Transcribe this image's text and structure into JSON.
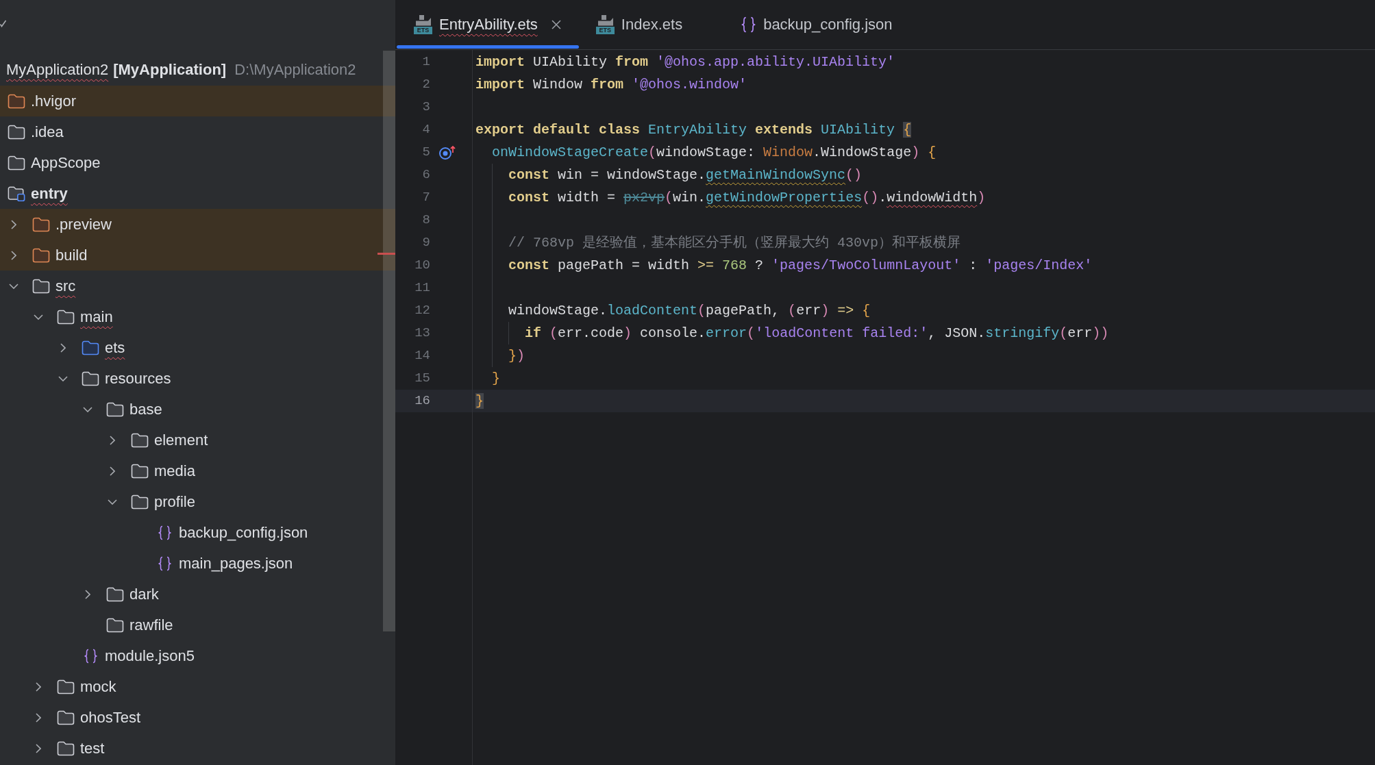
{
  "project_tree": {
    "name": "MyApplication2",
    "module_name": "[MyApplication]",
    "path": "D:\\MyApplication2",
    "misspelled": true,
    "children": [
      {
        "name": ".hvigor",
        "kind": "excluded_folder",
        "misspelled": false
      },
      {
        "name": ".idea",
        "kind": "folder",
        "misspelled": false
      },
      {
        "name": "AppScope",
        "kind": "folder",
        "misspelled": false
      },
      {
        "name": "entry",
        "kind": "module",
        "misspelled": true,
        "children": [
          {
            "name": ".preview",
            "kind": "excluded_folder",
            "expanded": false,
            "misspelled": false
          },
          {
            "name": "build",
            "kind": "excluded_folder",
            "expanded": false,
            "misspelled": false
          },
          {
            "name": "src",
            "kind": "folder",
            "expanded": true,
            "misspelled": true,
            "children": [
              {
                "name": "main",
                "kind": "folder",
                "expanded": true,
                "misspelled": true,
                "children": [
                  {
                    "name": "ets",
                    "kind": "source_folder",
                    "expanded": false,
                    "misspelled": true
                  },
                  {
                    "name": "resources",
                    "kind": "folder",
                    "expanded": true,
                    "misspelled": false,
                    "children": [
                      {
                        "name": "base",
                        "kind": "folder",
                        "expanded": true,
                        "misspelled": false,
                        "children": [
                          {
                            "name": "element",
                            "kind": "folder",
                            "expanded": false,
                            "misspelled": false
                          },
                          {
                            "name": "media",
                            "kind": "folder",
                            "expanded": false,
                            "misspelled": false
                          },
                          {
                            "name": "profile",
                            "kind": "folder",
                            "expanded": true,
                            "misspelled": false,
                            "children": [
                              {
                                "name": "backup_config.json",
                                "kind": "json_file",
                                "misspelled": false
                              },
                              {
                                "name": "main_pages.json",
                                "kind": "json_file",
                                "misspelled": false
                              }
                            ]
                          }
                        ]
                      },
                      {
                        "name": "dark",
                        "kind": "folder",
                        "expanded": false,
                        "misspelled": false
                      },
                      {
                        "name": "rawfile",
                        "kind": "folder",
                        "misspelled": false
                      }
                    ]
                  },
                  {
                    "name": "module.json5",
                    "kind": "json_file",
                    "misspelled": false
                  }
                ]
              },
              {
                "name": "mock",
                "kind": "folder",
                "expanded": false,
                "misspelled": false
              },
              {
                "name": "ohosTest",
                "kind": "folder",
                "expanded": false,
                "misspelled": false
              },
              {
                "name": "test",
                "kind": "folder",
                "expanded": false,
                "misspelled": false
              }
            ]
          }
        ]
      }
    ]
  },
  "editor": {
    "tabs": [
      {
        "label": "EntryAbility.ets",
        "kind": "ets",
        "icon_text": "ETS",
        "selected": true,
        "misspelled": true
      },
      {
        "label": "Index.ets",
        "kind": "ets",
        "icon_text": "ETS",
        "selected": false,
        "misspelled": false
      },
      {
        "label": "backup_config.json",
        "kind": "json",
        "selected": false,
        "misspelled": false
      }
    ],
    "lines": [
      {
        "number": "1",
        "current": false,
        "gutter_marker": false,
        "tokens": [
          {
            "text": "import",
            "kind": "keyword"
          },
          {
            "text": " UIAbility ",
            "kind": "plain"
          },
          {
            "text": "from",
            "kind": "keyword"
          },
          {
            "text": " '@ohos.app.ability.UIAbility'",
            "kind": "string"
          }
        ]
      },
      {
        "number": "2",
        "current": false,
        "gutter_marker": false,
        "tokens": [
          {
            "text": "import",
            "kind": "keyword"
          },
          {
            "text": " Window ",
            "kind": "plain"
          },
          {
            "text": "from",
            "kind": "keyword"
          },
          {
            "text": " '@ohos.window'",
            "kind": "string"
          }
        ]
      },
      {
        "number": "3",
        "current": false,
        "gutter_marker": false
      },
      {
        "number": "4",
        "current": false,
        "gutter_marker": false,
        "tokens": [
          {
            "text": "export default class",
            "kind": "keyword"
          },
          {
            "text": " EntryAbility",
            "kind": "class"
          },
          {
            "text": " extends",
            "kind": "keyword"
          },
          {
            "text": " UIAbility ",
            "kind": "class"
          },
          {
            "text": "{",
            "kind": "brace",
            "highlighted": true
          }
        ],
        "children": [
          {
            "number": "5",
            "current": false,
            "gutter_marker": true,
            "tokens": [
              {
                "text": "onWindowStageCreate",
                "kind": "function"
              },
              {
                "text": "(",
                "kind": "paren"
              },
              {
                "text": "windowStage: ",
                "kind": "plain"
              },
              {
                "text": "Window",
                "kind": "type"
              },
              {
                "text": ".WindowStage",
                "kind": "plain"
              },
              {
                "text": ")",
                "kind": "paren"
              },
              {
                "text": " {",
                "kind": "brace",
                "highlighted": false
              }
            ],
            "children": [
              {
                "number": "6",
                "current": false,
                "gutter_marker": false,
                "tokens": [
                  {
                    "text": "const",
                    "kind": "keyword"
                  },
                  {
                    "text": " win = windowStage.",
                    "kind": "plain"
                  },
                  {
                    "text": "getMainWindowSync",
                    "kind": "function",
                    "warning": true
                  },
                  {
                    "text": "()",
                    "kind": "paren"
                  }
                ]
              },
              {
                "number": "7",
                "current": false,
                "gutter_marker": false,
                "tokens": [
                  {
                    "text": "const",
                    "kind": "keyword"
                  },
                  {
                    "text": " width = ",
                    "kind": "plain"
                  },
                  {
                    "text": "px2vp",
                    "kind": "deprecated"
                  },
                  {
                    "text": "(",
                    "kind": "paren"
                  },
                  {
                    "text": "win.",
                    "kind": "plain"
                  },
                  {
                    "text": "getWindowProperties",
                    "kind": "function",
                    "warning": true
                  },
                  {
                    "text": "()",
                    "kind": "paren"
                  },
                  {
                    "text": ".",
                    "kind": "plain"
                  },
                  {
                    "text": "windowWidth",
                    "kind": "plain",
                    "error": true
                  },
                  {
                    "text": ")",
                    "kind": "paren"
                  }
                ]
              },
              {
                "number": "8",
                "current": false,
                "gutter_marker": false
              },
              {
                "number": "9",
                "current": false,
                "gutter_marker": false,
                "tokens": [
                  {
                    "text": "// 768vp 是经验值，基本能区分手机（竖屏最大约 430vp）和平板横屏",
                    "kind": "comment"
                  }
                ]
              },
              {
                "number": "10",
                "current": false,
                "gutter_marker": false,
                "tokens": [
                  {
                    "text": "const",
                    "kind": "keyword"
                  },
                  {
                    "text": " pagePath = width ",
                    "kind": "plain"
                  },
                  {
                    "text": ">=",
                    "kind": "operator"
                  },
                  {
                    "text": " 768",
                    "kind": "number"
                  },
                  {
                    "text": " ? ",
                    "kind": "plain"
                  },
                  {
                    "text": "'pages/TwoColumnLayout'",
                    "kind": "string"
                  },
                  {
                    "text": " : ",
                    "kind": "plain"
                  },
                  {
                    "text": "'pages/Index'",
                    "kind": "string"
                  }
                ]
              },
              {
                "number": "11",
                "current": false,
                "gutter_marker": false
              },
              {
                "number": "12",
                "current": false,
                "gutter_marker": false,
                "tokens": [
                  {
                    "text": "windowStage.",
                    "kind": "plain"
                  },
                  {
                    "text": "loadContent",
                    "kind": "function"
                  },
                  {
                    "text": "(",
                    "kind": "paren"
                  },
                  {
                    "text": "pagePath, ",
                    "kind": "plain"
                  },
                  {
                    "text": "(",
                    "kind": "paren"
                  },
                  {
                    "text": "err",
                    "kind": "plain"
                  },
                  {
                    "text": ")",
                    "kind": "paren"
                  },
                  {
                    "text": " =>",
                    "kind": "operator"
                  },
                  {
                    "text": " {",
                    "kind": "brace",
                    "highlighted": false
                  }
                ],
                "children": [
                  {
                    "number": "13",
                    "current": false,
                    "gutter_marker": false,
                    "tokens": [
                      {
                        "text": "if",
                        "kind": "keyword"
                      },
                      {
                        "text": " (",
                        "kind": "paren"
                      },
                      {
                        "text": "err.code",
                        "kind": "plain"
                      },
                      {
                        "text": ")",
                        "kind": "paren"
                      },
                      {
                        "text": " console.",
                        "kind": "plain"
                      },
                      {
                        "text": "error",
                        "kind": "function"
                      },
                      {
                        "text": "(",
                        "kind": "paren"
                      },
                      {
                        "text": "'loadContent failed:'",
                        "kind": "string"
                      },
                      {
                        "text": ", JSON.",
                        "kind": "plain"
                      },
                      {
                        "text": "stringify",
                        "kind": "function"
                      },
                      {
                        "text": "(",
                        "kind": "paren"
                      },
                      {
                        "text": "err",
                        "kind": "plain"
                      },
                      {
                        "text": "))",
                        "kind": "paren"
                      }
                    ]
                  }
                ]
              },
              {
                "number": "14",
                "current": false,
                "gutter_marker": false,
                "tokens": [
                  {
                    "text": "}",
                    "kind": "brace",
                    "highlighted": false
                  },
                  {
                    "text": ")",
                    "kind": "paren"
                  }
                ]
              }
            ]
          },
          {
            "number": "15",
            "current": false,
            "gutter_marker": false,
            "tokens": [
              {
                "text": "}",
                "kind": "brace",
                "highlighted": false
              }
            ]
          }
        ]
      },
      {
        "number": "16",
        "current": true,
        "gutter_marker": false,
        "tokens": [
          {
            "text": "}",
            "kind": "brace",
            "highlighted": true
          }
        ]
      }
    ]
  }
}
